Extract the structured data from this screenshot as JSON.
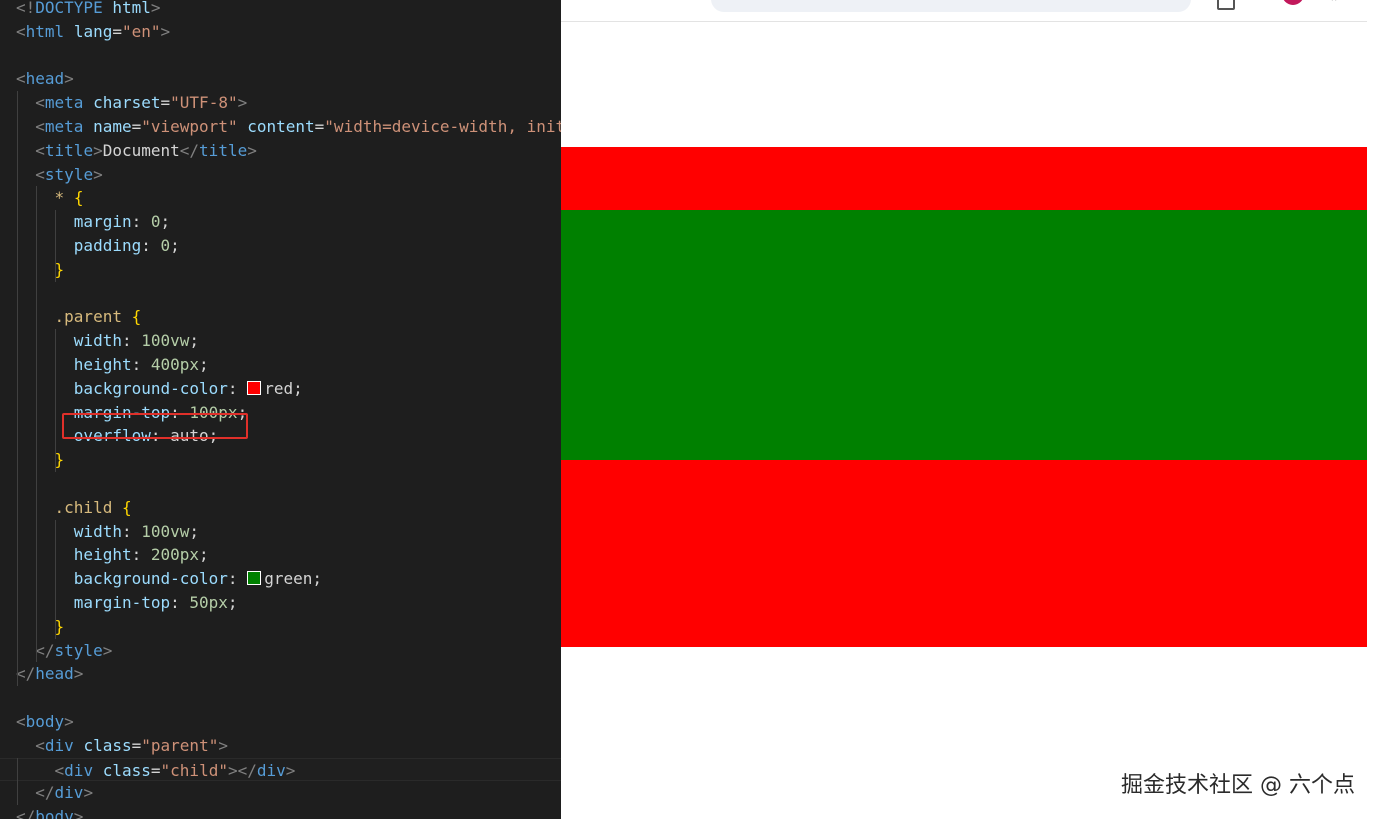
{
  "editor": {
    "lines": [
      {
        "segs": [
          {
            "c": "brk",
            "t": "<!"
          },
          {
            "c": "tag",
            "t": "DOCTYPE"
          },
          {
            "c": "txt",
            "t": " "
          },
          {
            "c": "attr",
            "t": "html"
          },
          {
            "c": "brk",
            "t": ">"
          }
        ]
      },
      {
        "segs": [
          {
            "c": "brk",
            "t": "<"
          },
          {
            "c": "tag",
            "t": "html"
          },
          {
            "c": "txt",
            "t": " "
          },
          {
            "c": "attr",
            "t": "lang"
          },
          {
            "c": "pun",
            "t": "="
          },
          {
            "c": "str",
            "t": "\"en\""
          },
          {
            "c": "brk",
            "t": ">"
          }
        ]
      },
      {
        "segs": []
      },
      {
        "segs": [
          {
            "c": "brk",
            "t": "<"
          },
          {
            "c": "tag",
            "t": "head"
          },
          {
            "c": "brk",
            "t": ">"
          }
        ]
      },
      {
        "segs": [
          {
            "c": "txt",
            "t": "  "
          },
          {
            "c": "brk",
            "t": "<"
          },
          {
            "c": "tag",
            "t": "meta"
          },
          {
            "c": "txt",
            "t": " "
          },
          {
            "c": "attr",
            "t": "charset"
          },
          {
            "c": "pun",
            "t": "="
          },
          {
            "c": "str",
            "t": "\"UTF-8\""
          },
          {
            "c": "brk",
            "t": ">"
          }
        ]
      },
      {
        "segs": [
          {
            "c": "txt",
            "t": "  "
          },
          {
            "c": "brk",
            "t": "<"
          },
          {
            "c": "tag",
            "t": "meta"
          },
          {
            "c": "txt",
            "t": " "
          },
          {
            "c": "attr",
            "t": "name"
          },
          {
            "c": "pun",
            "t": "="
          },
          {
            "c": "str",
            "t": "\"viewport\""
          },
          {
            "c": "txt",
            "t": " "
          },
          {
            "c": "attr",
            "t": "content"
          },
          {
            "c": "pun",
            "t": "="
          },
          {
            "c": "str",
            "t": "\"width=device-width, init"
          }
        ]
      },
      {
        "segs": [
          {
            "c": "txt",
            "t": "  "
          },
          {
            "c": "brk",
            "t": "<"
          },
          {
            "c": "tag",
            "t": "title"
          },
          {
            "c": "brk",
            "t": ">"
          },
          {
            "c": "txt",
            "t": "Document"
          },
          {
            "c": "brk",
            "t": "</"
          },
          {
            "c": "tag",
            "t": "title"
          },
          {
            "c": "brk",
            "t": ">"
          }
        ]
      },
      {
        "segs": [
          {
            "c": "txt",
            "t": "  "
          },
          {
            "c": "brk",
            "t": "<"
          },
          {
            "c": "tag",
            "t": "style"
          },
          {
            "c": "brk",
            "t": ">"
          }
        ]
      },
      {
        "segs": [
          {
            "c": "txt",
            "t": "    "
          },
          {
            "c": "sel",
            "t": "*"
          },
          {
            "c": "txt",
            "t": " "
          },
          {
            "c": "brc",
            "t": "{"
          }
        ]
      },
      {
        "segs": [
          {
            "c": "txt",
            "t": "      "
          },
          {
            "c": "prop",
            "t": "margin"
          },
          {
            "c": "pun",
            "t": ": "
          },
          {
            "c": "num",
            "t": "0"
          },
          {
            "c": "pun",
            "t": ";"
          }
        ]
      },
      {
        "segs": [
          {
            "c": "txt",
            "t": "      "
          },
          {
            "c": "prop",
            "t": "padding"
          },
          {
            "c": "pun",
            "t": ": "
          },
          {
            "c": "num",
            "t": "0"
          },
          {
            "c": "pun",
            "t": ";"
          }
        ]
      },
      {
        "segs": [
          {
            "c": "txt",
            "t": "    "
          },
          {
            "c": "brc",
            "t": "}"
          }
        ]
      },
      {
        "segs": []
      },
      {
        "segs": [
          {
            "c": "txt",
            "t": "    "
          },
          {
            "c": "sel",
            "t": ".parent"
          },
          {
            "c": "txt",
            "t": " "
          },
          {
            "c": "brc",
            "t": "{"
          }
        ]
      },
      {
        "segs": [
          {
            "c": "txt",
            "t": "      "
          },
          {
            "c": "prop",
            "t": "width"
          },
          {
            "c": "pun",
            "t": ": "
          },
          {
            "c": "num",
            "t": "100vw"
          },
          {
            "c": "pun",
            "t": ";"
          }
        ]
      },
      {
        "segs": [
          {
            "c": "txt",
            "t": "      "
          },
          {
            "c": "prop",
            "t": "height"
          },
          {
            "c": "pun",
            "t": ": "
          },
          {
            "c": "num",
            "t": "400px"
          },
          {
            "c": "pun",
            "t": ";"
          }
        ]
      },
      {
        "segs": [
          {
            "c": "txt",
            "t": "      "
          },
          {
            "c": "prop",
            "t": "background-color"
          },
          {
            "c": "pun",
            "t": ": "
          },
          {
            "c": "swatch",
            "t": "#ff0000"
          },
          {
            "c": "val",
            "t": "red"
          },
          {
            "c": "pun",
            "t": ";"
          }
        ]
      },
      {
        "segs": [
          {
            "c": "txt",
            "t": "      "
          },
          {
            "c": "prop",
            "t": "margin-top"
          },
          {
            "c": "pun",
            "t": ": "
          },
          {
            "c": "num",
            "t": "100px"
          },
          {
            "c": "pun",
            "t": ";"
          }
        ]
      },
      {
        "segs": [
          {
            "c": "txt",
            "t": "      "
          },
          {
            "c": "prop",
            "t": "overflow"
          },
          {
            "c": "pun",
            "t": ": "
          },
          {
            "c": "val",
            "t": "auto"
          },
          {
            "c": "pun",
            "t": ";"
          }
        ]
      },
      {
        "segs": [
          {
            "c": "txt",
            "t": "    "
          },
          {
            "c": "brc",
            "t": "}"
          }
        ]
      },
      {
        "segs": []
      },
      {
        "segs": [
          {
            "c": "txt",
            "t": "    "
          },
          {
            "c": "sel",
            "t": ".child"
          },
          {
            "c": "txt",
            "t": " "
          },
          {
            "c": "brc",
            "t": "{"
          }
        ]
      },
      {
        "segs": [
          {
            "c": "txt",
            "t": "      "
          },
          {
            "c": "prop",
            "t": "width"
          },
          {
            "c": "pun",
            "t": ": "
          },
          {
            "c": "num",
            "t": "100vw"
          },
          {
            "c": "pun",
            "t": ";"
          }
        ]
      },
      {
        "segs": [
          {
            "c": "txt",
            "t": "      "
          },
          {
            "c": "prop",
            "t": "height"
          },
          {
            "c": "pun",
            "t": ": "
          },
          {
            "c": "num",
            "t": "200px"
          },
          {
            "c": "pun",
            "t": ";"
          }
        ]
      },
      {
        "segs": [
          {
            "c": "txt",
            "t": "      "
          },
          {
            "c": "prop",
            "t": "background-color"
          },
          {
            "c": "pun",
            "t": ": "
          },
          {
            "c": "swatch",
            "t": "#008000"
          },
          {
            "c": "val",
            "t": "green"
          },
          {
            "c": "pun",
            "t": ";"
          }
        ]
      },
      {
        "segs": [
          {
            "c": "txt",
            "t": "      "
          },
          {
            "c": "prop",
            "t": "margin-top"
          },
          {
            "c": "pun",
            "t": ": "
          },
          {
            "c": "num",
            "t": "50px"
          },
          {
            "c": "pun",
            "t": ";"
          }
        ]
      },
      {
        "segs": [
          {
            "c": "txt",
            "t": "    "
          },
          {
            "c": "brc",
            "t": "}"
          }
        ]
      },
      {
        "segs": [
          {
            "c": "txt",
            "t": "  "
          },
          {
            "c": "brk",
            "t": "</"
          },
          {
            "c": "tag",
            "t": "style"
          },
          {
            "c": "brk",
            "t": ">"
          }
        ]
      },
      {
        "segs": [
          {
            "c": "brk",
            "t": "</"
          },
          {
            "c": "tag",
            "t": "head"
          },
          {
            "c": "brk",
            "t": ">"
          }
        ]
      },
      {
        "segs": []
      },
      {
        "segs": [
          {
            "c": "brk",
            "t": "<"
          },
          {
            "c": "tag",
            "t": "body"
          },
          {
            "c": "brk",
            "t": ">"
          }
        ]
      },
      {
        "segs": [
          {
            "c": "txt",
            "t": "  "
          },
          {
            "c": "brk",
            "t": "<"
          },
          {
            "c": "tag",
            "t": "div"
          },
          {
            "c": "txt",
            "t": " "
          },
          {
            "c": "attr",
            "t": "class"
          },
          {
            "c": "pun",
            "t": "="
          },
          {
            "c": "str",
            "t": "\"parent\""
          },
          {
            "c": "brk",
            "t": ">"
          }
        ]
      },
      {
        "segs": [
          {
            "c": "txt",
            "t": "    "
          },
          {
            "c": "brk",
            "t": "<"
          },
          {
            "c": "tag",
            "t": "div"
          },
          {
            "c": "txt",
            "t": " "
          },
          {
            "c": "attr",
            "t": "class"
          },
          {
            "c": "pun",
            "t": "="
          },
          {
            "c": "str",
            "t": "\"child\""
          },
          {
            "c": "brk",
            "t": "></"
          },
          {
            "c": "tag",
            "t": "div"
          },
          {
            "c": "brk",
            "t": ">"
          }
        ],
        "active": true
      },
      {
        "segs": [
          {
            "c": "txt",
            "t": "  "
          },
          {
            "c": "brk",
            "t": "</"
          },
          {
            "c": "tag",
            "t": "div"
          },
          {
            "c": "brk",
            "t": ">"
          }
        ]
      },
      {
        "segs": [
          {
            "c": "brk",
            "t": "</"
          },
          {
            "c": "tag",
            "t": "body"
          },
          {
            "c": "brk",
            "t": ">"
          }
        ]
      }
    ],
    "highlight_color": "#e0302a"
  },
  "browser": {
    "parent_color": "#ff0000",
    "child_color": "#008000",
    "page_background": "#ffffff"
  },
  "watermark": "掘金技术社区 @ 六个点"
}
